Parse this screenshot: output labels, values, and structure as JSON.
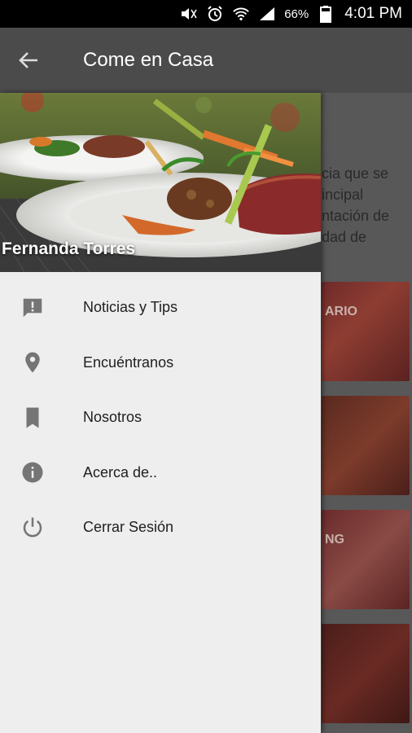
{
  "status_bar": {
    "battery_percent": "66%",
    "time": "4:01 PM",
    "icons": [
      "mute-icon",
      "alarm-icon",
      "wifi-icon",
      "signal-icon",
      "battery-icon"
    ]
  },
  "app_bar": {
    "title": "Come en Casa",
    "back_icon": "arrow-back-icon"
  },
  "background": {
    "paragraph": "cia que se\nincipal\nntación de\ndad de",
    "cards": [
      "ARIO",
      "",
      "NG",
      ""
    ]
  },
  "drawer": {
    "user_name": "Fernanda Torres",
    "items": [
      {
        "label": "Noticias y Tips",
        "icon": "feedback-icon"
      },
      {
        "label": "Encuéntranos",
        "icon": "location-pin-icon"
      },
      {
        "label": "Nosotros",
        "icon": "bookmark-icon"
      },
      {
        "label": "Acerca de..",
        "icon": "info-icon"
      },
      {
        "label": "Cerrar Sesión",
        "icon": "power-icon"
      }
    ]
  },
  "colors": {
    "icon_gray": "#757575",
    "drawer_bg": "#eeeeee",
    "scrim_appbar": "#4b4b4b"
  }
}
